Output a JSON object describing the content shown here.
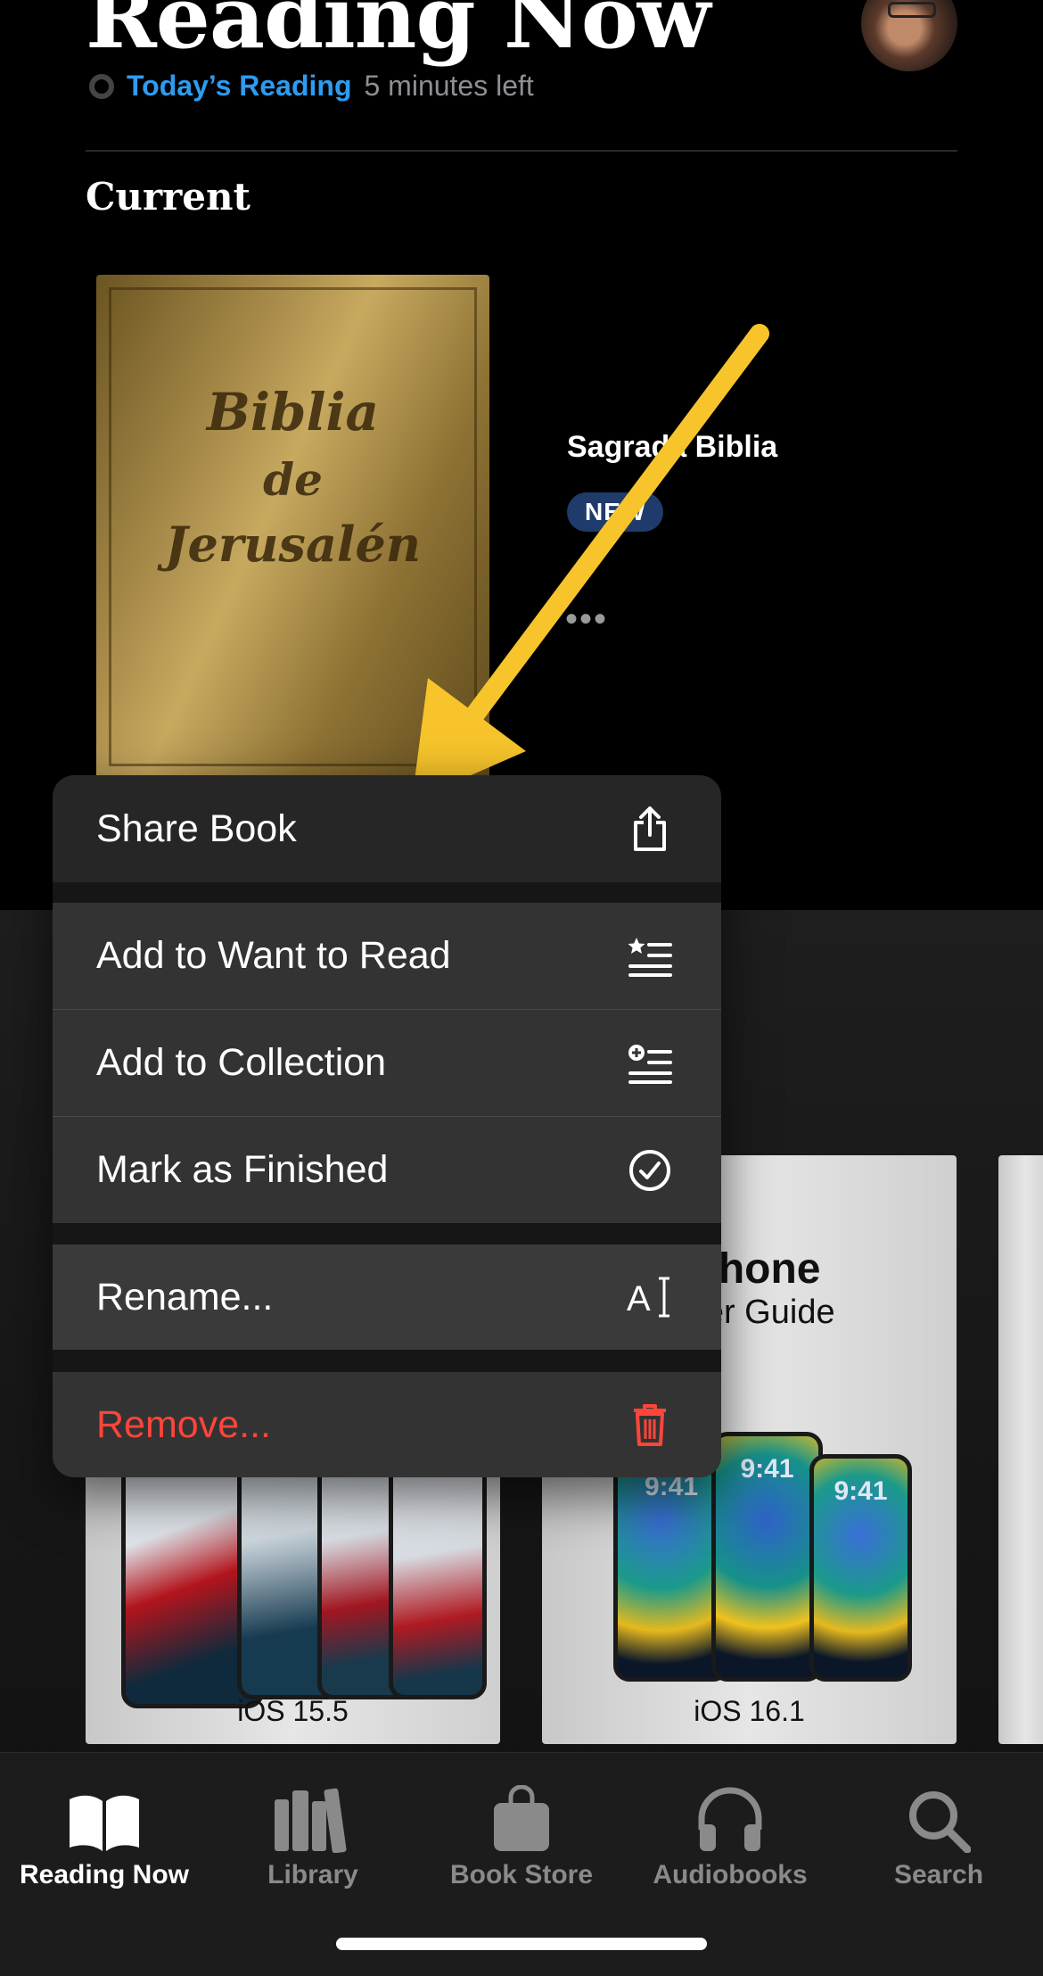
{
  "header": {
    "title": "Reading Now",
    "today_link": "Today’s Reading",
    "time_left": "5 minutes left"
  },
  "current": {
    "section_title": "Current",
    "book": {
      "cover_line1": "Biblia",
      "cover_line2": "de",
      "cover_line3": "Jerusalén",
      "title": "Sagrada Biblia",
      "badge": "NEW",
      "more": "•••"
    }
  },
  "library_cards": [
    {
      "caption": "iOS 15.5",
      "phone_times": [
        "",
        "",
        "",
        ""
      ]
    },
    {
      "heading1": "iPhone",
      "heading2": "User Guide",
      "caption": "iOS 16.1",
      "phone_times": [
        "9:41",
        "9:41",
        "9:41"
      ]
    }
  ],
  "context_menu": {
    "items": [
      {
        "label": "Share Book",
        "icon": "share-icon"
      },
      {
        "label": "Add to Want to Read",
        "icon": "star-list-icon"
      },
      {
        "label": "Add to Collection",
        "icon": "plus-list-icon"
      },
      {
        "label": "Mark as Finished",
        "icon": "checkmark-circle-icon"
      },
      {
        "label": "Rename...",
        "icon": "rename-icon"
      },
      {
        "label": "Remove...",
        "icon": "trash-icon",
        "destructive": true
      }
    ],
    "destructive_color": "#ff453a"
  },
  "tabbar": {
    "tabs": [
      {
        "label": "Reading Now",
        "active": true
      },
      {
        "label": "Library"
      },
      {
        "label": "Book Store"
      },
      {
        "label": "Audiobooks"
      },
      {
        "label": "Search"
      }
    ]
  },
  "colors": {
    "accent": "#2d9cf0",
    "badge": "#1f3b6b",
    "annotation_arrow": "#f7c52b"
  }
}
